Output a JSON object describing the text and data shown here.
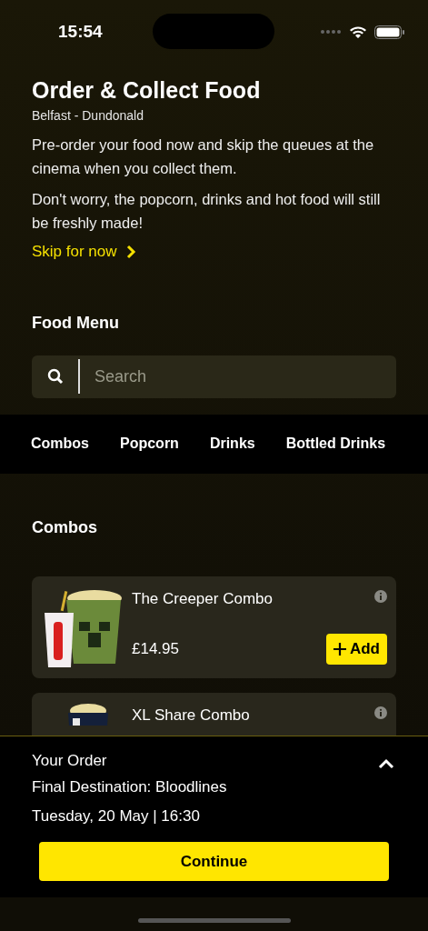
{
  "status_bar": {
    "time": "15:54"
  },
  "header": {
    "title": "Order & Collect Food",
    "cinema": "Belfast - Dundonald",
    "paragraphs": [
      "Pre-order your food now and skip the queues at the cinema when you collect them.",
      "Don't worry, the popcorn, drinks and hot food will still be freshly made!"
    ],
    "skip_link": "Skip for now"
  },
  "menu_title": "Food Menu",
  "search": {
    "placeholder": "Search"
  },
  "categories": [
    "Combos",
    "Popcorn",
    "Drinks",
    "Bottled Drinks"
  ],
  "section_title": "Combos",
  "items": [
    {
      "name": "The Creeper Combo",
      "price": "£14.95",
      "add_label": "Add"
    },
    {
      "name": "XL Share Combo"
    }
  ],
  "order": {
    "title": "Your Order",
    "film": "Final Destination: Bloodlines",
    "showtime": "Tuesday, 20 May | 16:30",
    "expanded": false,
    "button": "Continue"
  }
}
